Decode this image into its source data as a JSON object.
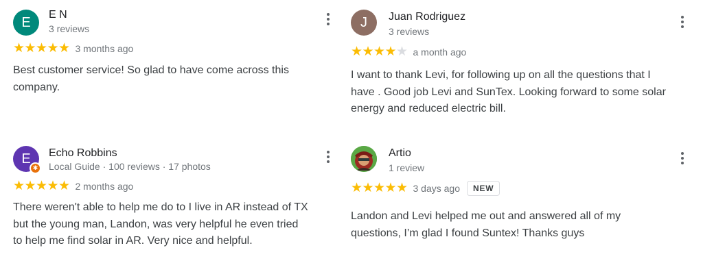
{
  "reviews": [
    {
      "author": "E N",
      "initial": "E",
      "avatar_color": "#00897b",
      "meta": "3 reviews",
      "rating": 5,
      "date": "3 months ago",
      "text": "Best customer service! So glad to have come across this company."
    },
    {
      "author": "Juan Rodriguez",
      "initial": "J",
      "avatar_color": "#8d6e63",
      "meta": "3 reviews",
      "rating": 4,
      "date": "a month ago",
      "text": "I want to thank Levi, for following up on all the questions that I have . Good job Levi and SunTex. Looking forward to some solar energy and reduced electric bill."
    },
    {
      "author": "Echo Robbins",
      "initial": "E",
      "avatar_color": "#5e35b1",
      "meta": "Local Guide · 100 reviews · 17 photos",
      "rating": 5,
      "date": "2 months ago",
      "text": "There weren't able to help me do to I live in AR instead of TX but the young man, Landon, was very helpful he even tried to help me find solar in AR. Very nice and helpful."
    },
    {
      "author": "Artio",
      "meta": "1 review",
      "rating": 5,
      "date": "3 days ago",
      "badge": "NEW",
      "text": "Landon and Levi helped me out and answered all of my questions, I’m glad I found Suntex! Thanks guys"
    }
  ],
  "icons": {
    "star": "star-icon",
    "more": "more-vert-icon",
    "local_guide": "local-guide-badge-icon"
  },
  "colors": {
    "star_filled": "#fbbc04",
    "star_empty": "#dadce0",
    "secondary_text": "#70757a",
    "local_guide_badge": "#e8710a"
  }
}
